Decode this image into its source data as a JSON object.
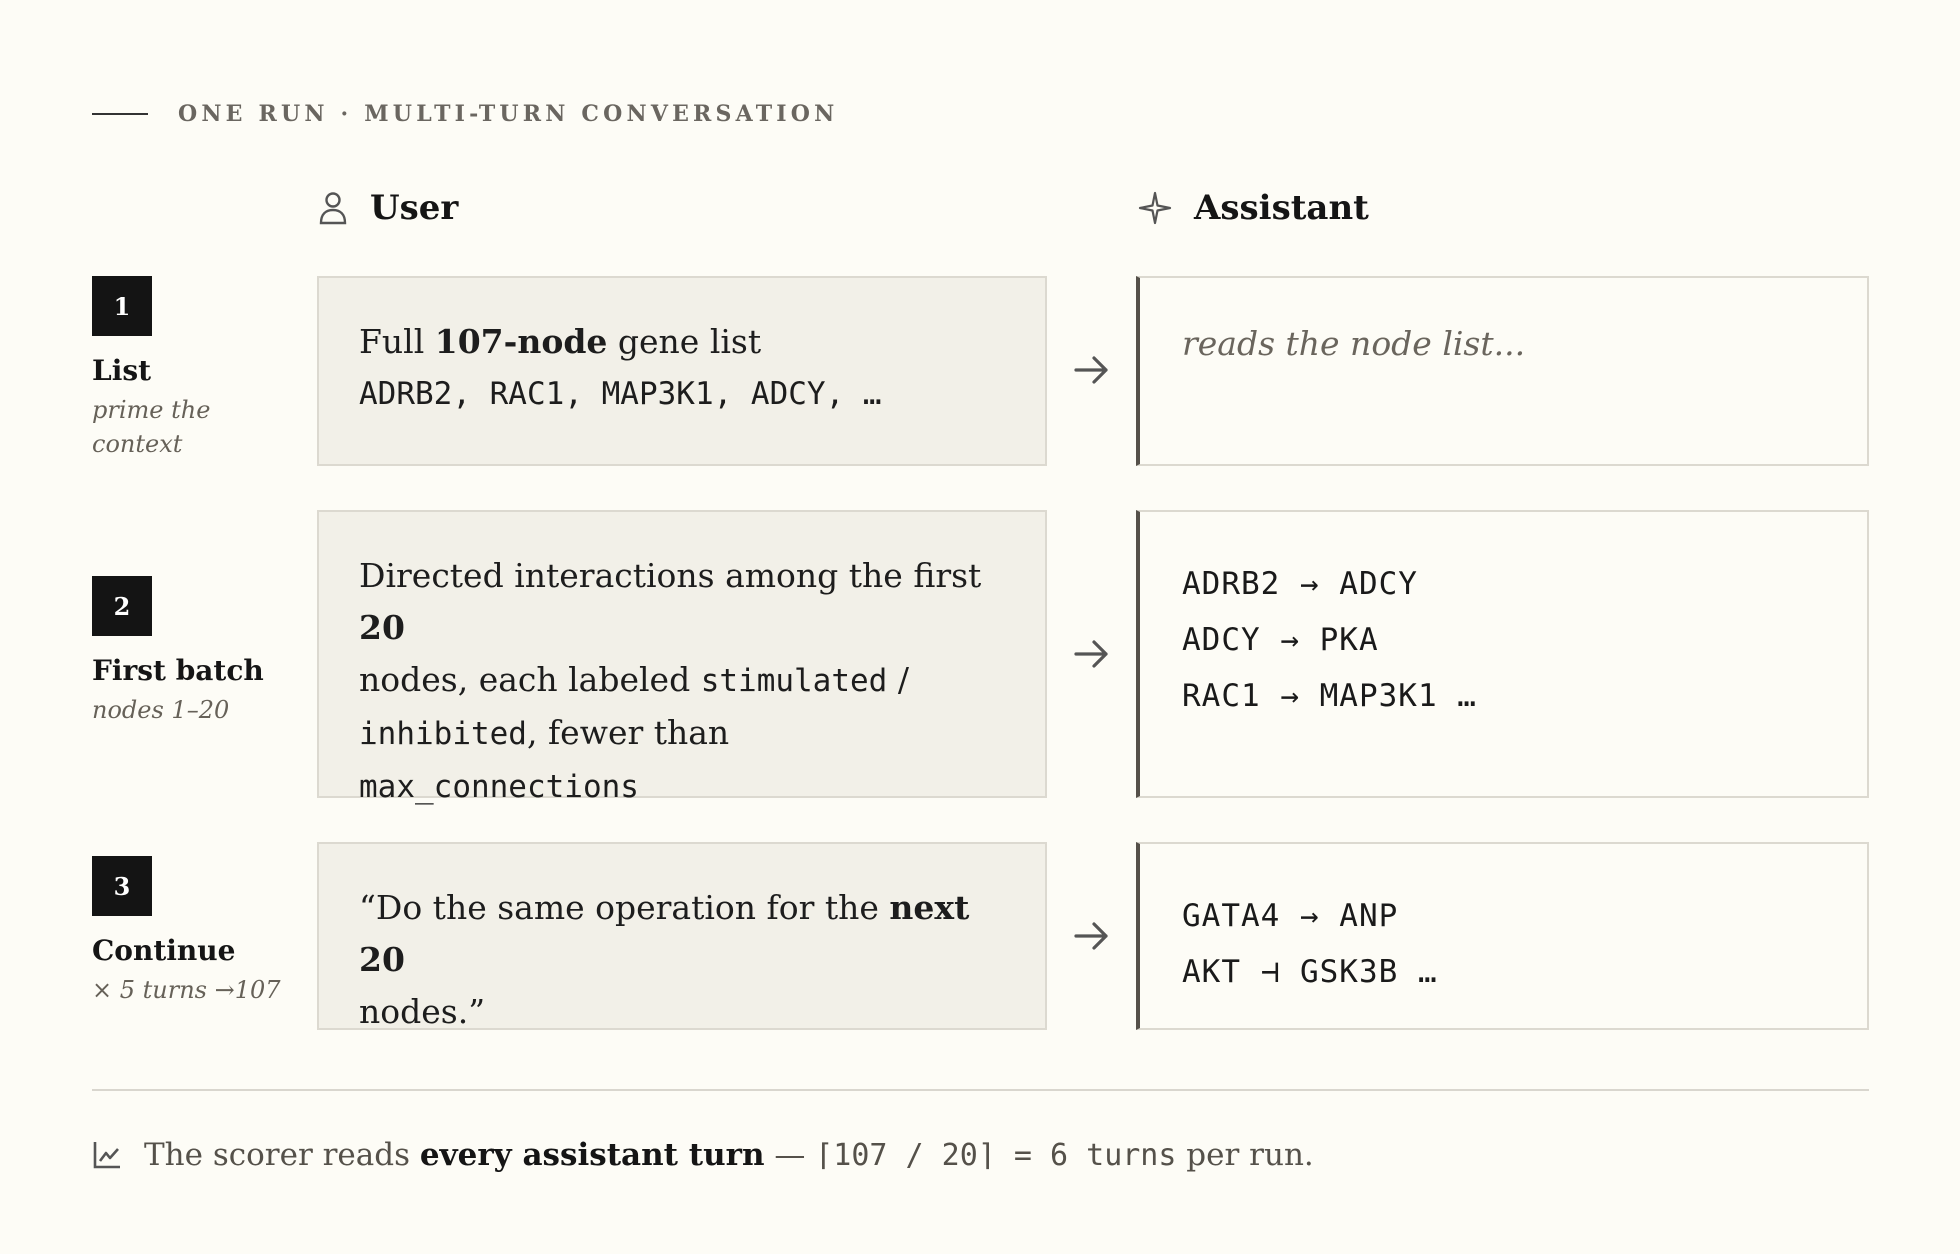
{
  "header": {
    "eyebrow": "ONE RUN · MULTI-TURN CONVERSATION"
  },
  "columns": {
    "user": "User",
    "assistant": "Assistant"
  },
  "steps": [
    {
      "num": "1",
      "title": "List",
      "sub": "prime the context",
      "user": {
        "pre": "Full ",
        "bold": "107-node",
        "post": " gene list",
        "code": "ADRB2, RAC1, MAP3K1, ADCY, …"
      },
      "assistant": {
        "note": "reads the node list..."
      }
    },
    {
      "num": "2",
      "title": "First batch",
      "sub": "nodes 1–20",
      "user": {
        "pre": "Directed interactions among the first ",
        "bold": "20",
        "mid1": "nodes, each labeled ",
        "code1": "stimulated",
        "mid2": " /",
        "code2": "inhibited",
        "mid3": ", fewer than",
        "code3": "max_connections"
      },
      "assistant": {
        "lines": [
          "ADRB2 → ADCY",
          "ADCY → PKA",
          "RAC1 → MAP3K1 …"
        ]
      }
    },
    {
      "num": "3",
      "title": "Continue",
      "sub": "× 5 turns →107",
      "user": {
        "pre": "“Do the same operation for the ",
        "bold": "next 20",
        "post": "nodes.”"
      },
      "assistant": {
        "lines": [
          "GATA4 → ANP",
          "AKT ⊣ GSK3B …"
        ]
      }
    }
  ],
  "footer": {
    "pre": "The scorer reads ",
    "bold": "every assistant turn",
    "dash": " — ",
    "formula": "⌈107 / 20⌉ = 6 turns",
    "post": " per run."
  },
  "icons": {
    "user": "person-icon",
    "assistant": "sparkle-icon",
    "arrow": "arrow-right-icon",
    "footer": "chart-line-icon"
  },
  "colors": {
    "background": "#fdfcf6",
    "user_box": "#f2f0e8",
    "step_badge": "#141414",
    "accent_border": "#555049"
  }
}
